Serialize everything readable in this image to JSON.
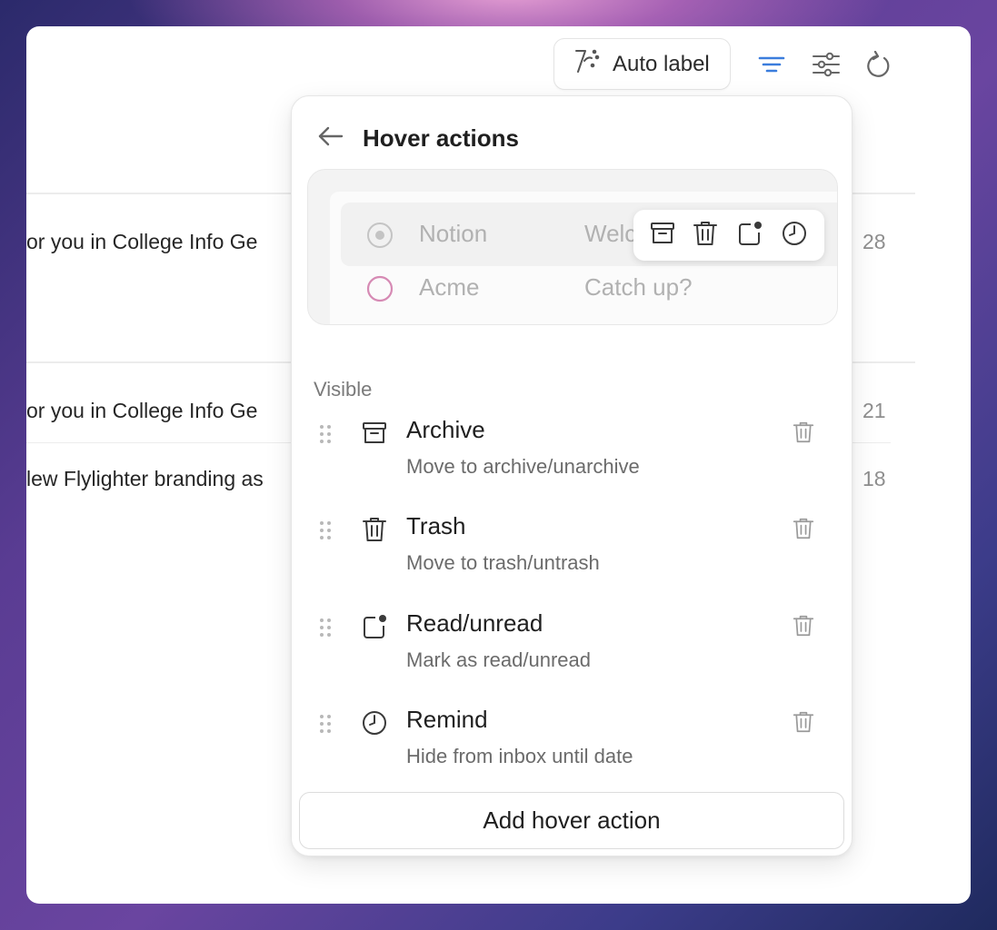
{
  "toolbar": {
    "auto_label": "Auto label",
    "icons": [
      "auto-label-icon",
      "filter-icon",
      "settings-sliders-icon",
      "refresh-icon"
    ],
    "accent_color": "#3b7ddd"
  },
  "background_list": {
    "rows": [
      {
        "text": "or you in College Info Ge",
        "date": "28"
      },
      {
        "text": "or you in College Info Ge",
        "date": "21"
      },
      {
        "text": "lew Flylighter branding as",
        "date": "18"
      }
    ]
  },
  "popover": {
    "title": "Hover actions",
    "back_icon": "arrow-left-icon",
    "preview": {
      "row1": {
        "sender": "Notion",
        "subject": "Welc"
      },
      "row2": {
        "sender": "Acme",
        "subject": "Catch up?"
      },
      "hover_icons": [
        "archive-icon",
        "trash-icon",
        "read-unread-icon",
        "remind-icon"
      ],
      "unread_color": "#d68ab4"
    },
    "section_label": "Visible",
    "actions": [
      {
        "title": "Archive",
        "description": "Move to archive/unarchive",
        "icon": "archive-icon"
      },
      {
        "title": "Trash",
        "description": "Move to trash/untrash",
        "icon": "trash-icon"
      },
      {
        "title": "Read/unread",
        "description": "Mark as read/unread",
        "icon": "read-unread-icon"
      },
      {
        "title": "Remind",
        "description": "Hide from inbox until date",
        "icon": "remind-icon"
      }
    ],
    "add_button": "Add hover action"
  }
}
